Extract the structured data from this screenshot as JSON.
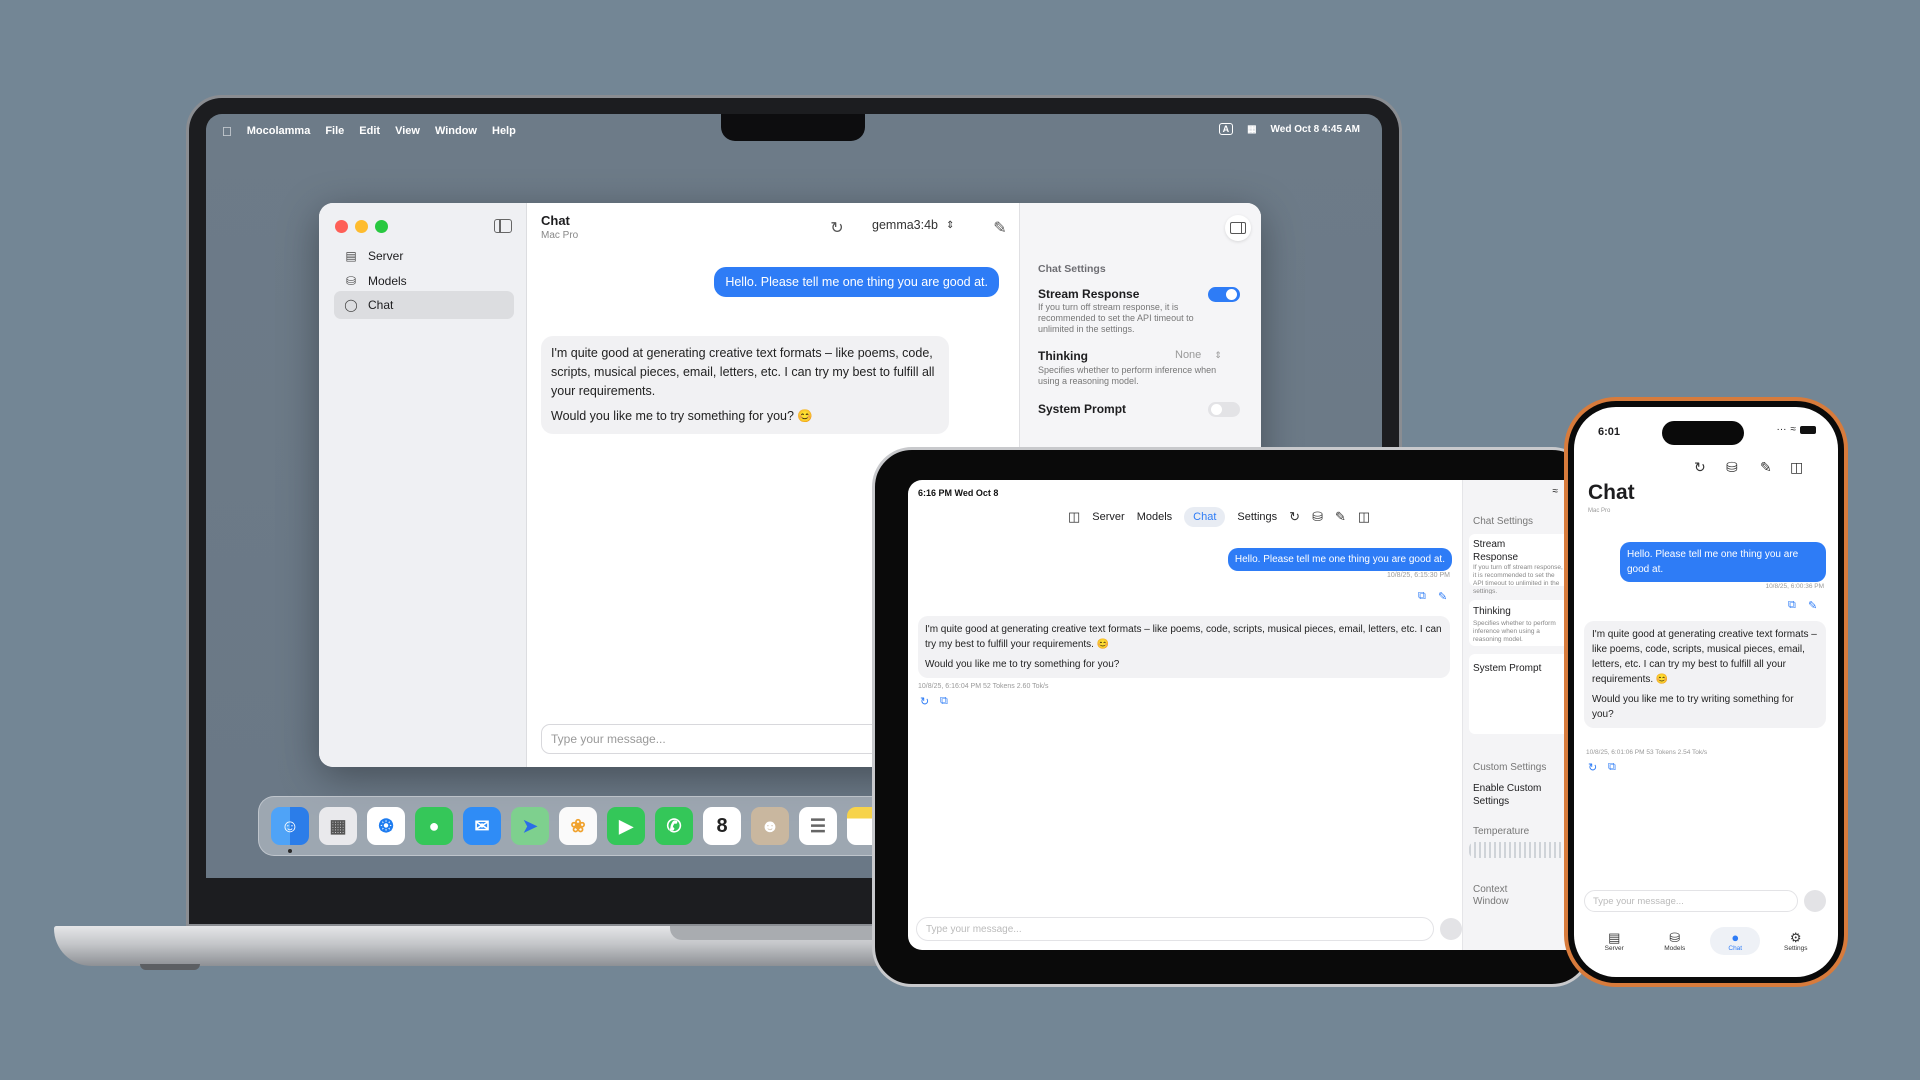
{
  "mac": {
    "menubar": {
      "app_name": "Mocolamma",
      "items": [
        "File",
        "Edit",
        "View",
        "Window",
        "Help"
      ],
      "input_indicator": "A",
      "datetime": "Wed Oct 8  4:45 AM"
    },
    "window": {
      "title": "Chat",
      "subtitle": "Mac Pro",
      "model": "gemma3:4b",
      "sidebar": [
        {
          "label": "Server",
          "icon": "server-icon"
        },
        {
          "label": "Models",
          "icon": "models-icon"
        },
        {
          "label": "Chat",
          "icon": "chat-icon",
          "active": true
        }
      ],
      "user_message": "Hello. Please tell me one thing you are good at.",
      "bot_message_p1": "I'm quite good at generating creative text formats – like poems, code, scripts, musical pieces, email, letters, etc. I can try my best to fulfill all your requirements.",
      "bot_message_p2": "Would you like me to try something for you? 😊",
      "input_placeholder": "Type your message...",
      "settings": {
        "section": "Chat Settings",
        "stream_label": "Stream Response",
        "stream_desc": "If you turn off stream response, it is recommended to set the API timeout to unlimited in the settings.",
        "stream_on": true,
        "thinking_label": "Thinking",
        "thinking_value": "None",
        "thinking_desc": "Specifies whether to perform inference when using a reasoning model.",
        "system_prompt_label": "System Prompt",
        "system_prompt_on": false
      }
    },
    "dock": [
      "finder",
      "launchpad",
      "safari",
      "messages",
      "mail",
      "maps",
      "photos",
      "facetime",
      "phone",
      "calendar",
      "contacts",
      "reminders",
      "notes"
    ],
    "dock_calendar_day": "8"
  },
  "ipad": {
    "status_time": "6:16 PM  Wed Oct 8",
    "nav": {
      "server": "Server",
      "models": "Models",
      "chat": "Chat",
      "settings": "Settings"
    },
    "user_message": "Hello. Please tell me one thing you are good at.",
    "user_timestamp": "10/8/25, 6:15:30 PM",
    "bot_message_p1": "I'm quite good at generating creative text formats – like poems, code, scripts, musical pieces, email, letters, etc.  I can try my best to fulfill your requirements. 😊",
    "bot_message_p2": "Would you like me to try something for you?",
    "bot_meta": "10/8/25, 6:16:04 PM   52 Tokens   2.60 Tok/s",
    "input_placeholder": "Type your message...",
    "settings": {
      "section": "Chat Settings",
      "stream_label": "Stream Response",
      "stream_desc": "If you turn off stream response, it is recommended to set the API timeout to unlimited in the settings.",
      "thinking_label": "Thinking",
      "thinking_desc": "Specifies whether to perform inference when using a reasoning model.",
      "system_prompt_label": "System Prompt",
      "custom_section": "Custom Settings",
      "enable_custom_label": "Enable Custom Settings",
      "temperature_label": "Temperature",
      "context_label": "Context Window"
    }
  },
  "iphone": {
    "status_time": "6:01",
    "title": "Chat",
    "subtitle": "Mac Pro",
    "user_message": "Hello. Please tell me one thing you are good at.",
    "user_timestamp": "10/8/25, 6:00:36 PM",
    "bot_message_p1": "I'm quite good at generating creative text formats – like poems, code, scripts, musical pieces, email, letters, etc. I can try my best to fulfill all your requirements. 😊",
    "bot_message_p2": "Would you like me to try writing something for you?",
    "bot_meta": "10/8/25, 6:01:06 PM   53 Tokens   2.54 Tok/s",
    "input_placeholder": "Type your message...",
    "tabs": {
      "server": "Server",
      "models": "Models",
      "chat": "Chat",
      "settings": "Settings"
    }
  },
  "colors": {
    "accent": "#2e7cf6",
    "background": "#738695",
    "iphone_frame": "#d77b3c"
  }
}
